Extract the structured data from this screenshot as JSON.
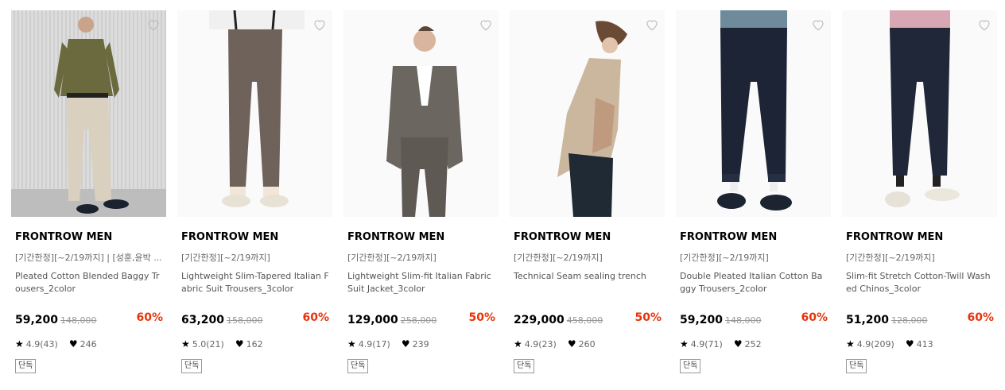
{
  "products": [
    {
      "brand": "FRONTROW MEN",
      "promo": "[기간한정][~2/19까지] | [성훈,윤박 ...",
      "name": "Pleated Cotton Blended Baggy Trousers_2color",
      "price": "59,200",
      "orig": "148,000",
      "disc": "60%",
      "rating": "4.9(43)",
      "likes": "246",
      "badge": "단독"
    },
    {
      "brand": "FRONTROW MEN",
      "promo": "[기간한정][~2/19까지]",
      "name": "Lightweight Slim-Tapered Italian Fabric Suit Trousers_3color",
      "price": "63,200",
      "orig": "158,000",
      "disc": "60%",
      "rating": "5.0(21)",
      "likes": "162",
      "badge": "단독"
    },
    {
      "brand": "FRONTROW MEN",
      "promo": "[기간한정][~2/19까지]",
      "name": "Lightweight Slim-fit Italian Fabric Suit Jacket_3color",
      "price": "129,000",
      "orig": "258,000",
      "disc": "50%",
      "rating": "4.9(17)",
      "likes": "239",
      "badge": "단독"
    },
    {
      "brand": "FRONTROW MEN",
      "promo": "[기간한정][~2/19까지]",
      "name": "Technical Seam sealing trench",
      "price": "229,000",
      "orig": "458,000",
      "disc": "50%",
      "rating": "4.9(23)",
      "likes": "260",
      "badge": "단독"
    },
    {
      "brand": "FRONTROW MEN",
      "promo": "[기간한정][~2/19까지]",
      "name": "Double Pleated Italian Cotton Baggy Trousers_2color",
      "price": "59,200",
      "orig": "148,000",
      "disc": "60%",
      "rating": "4.9(71)",
      "likes": "252",
      "badge": "단독"
    },
    {
      "brand": "FRONTROW MEN",
      "promo": "[기간한정][~2/19까지]",
      "name": "Slim-fit Stretch Cotton-Twill Washed Chinos_3color",
      "price": "51,200",
      "orig": "128,000",
      "disc": "60%",
      "rating": "4.9(209)",
      "likes": "413",
      "badge": "단독"
    }
  ],
  "icons": {
    "wishlist": "heart-outline-icon",
    "rating": "star-icon",
    "likes": "heart-filled-icon"
  },
  "colors": {
    "discount": "#e8340a"
  }
}
